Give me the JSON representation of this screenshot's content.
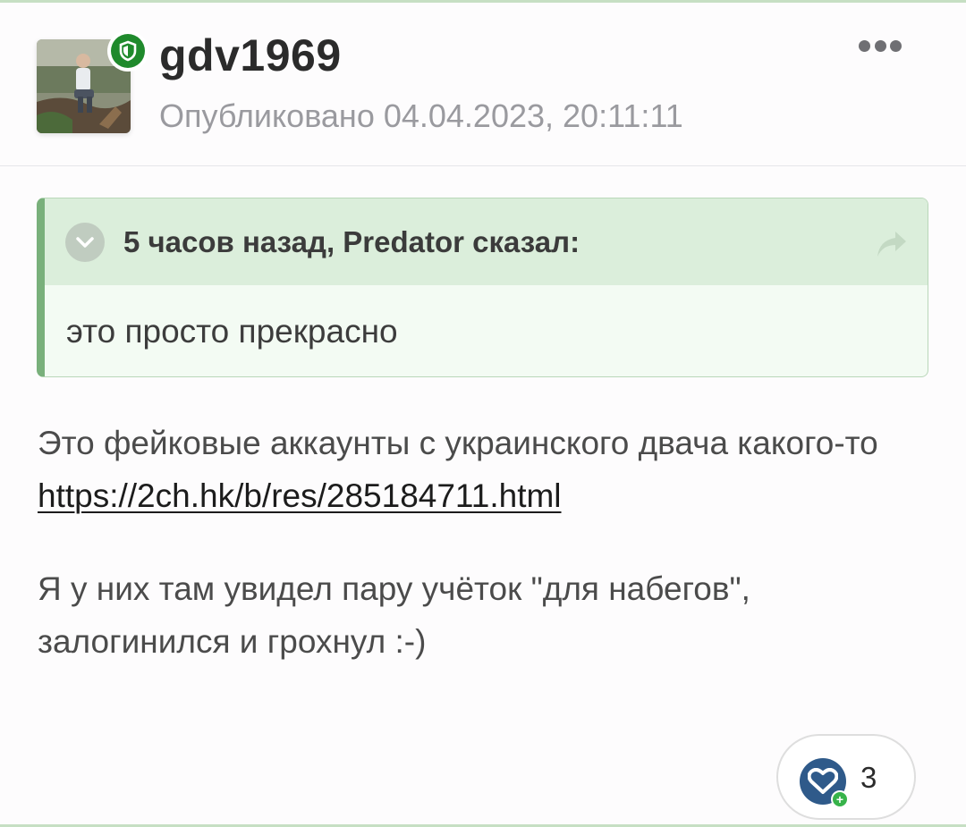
{
  "post": {
    "author": "gdv1969",
    "published": "Опубликовано 04.04.2023, 20:11:11"
  },
  "quote": {
    "citation": "5 часов назад, Predator сказал:",
    "text": "это просто прекрасно"
  },
  "content": {
    "paragraph1_text": "Это фейковые аккаунты с украинского двача какого-то",
    "paragraph1_link": "https://2ch.hk/b/res/285184711.html",
    "paragraph2": "Я у них там увидел пару учёток \"для набегов\", залогинился и грохнул :-)"
  },
  "reaction": {
    "icon": "heart-icon",
    "count": "3"
  },
  "colors": {
    "badge": "#1f8a2c",
    "quote_border": "#79b07b",
    "quote_header_bg": "#dbeedb",
    "reaction_heart": "#2f5a8a"
  }
}
